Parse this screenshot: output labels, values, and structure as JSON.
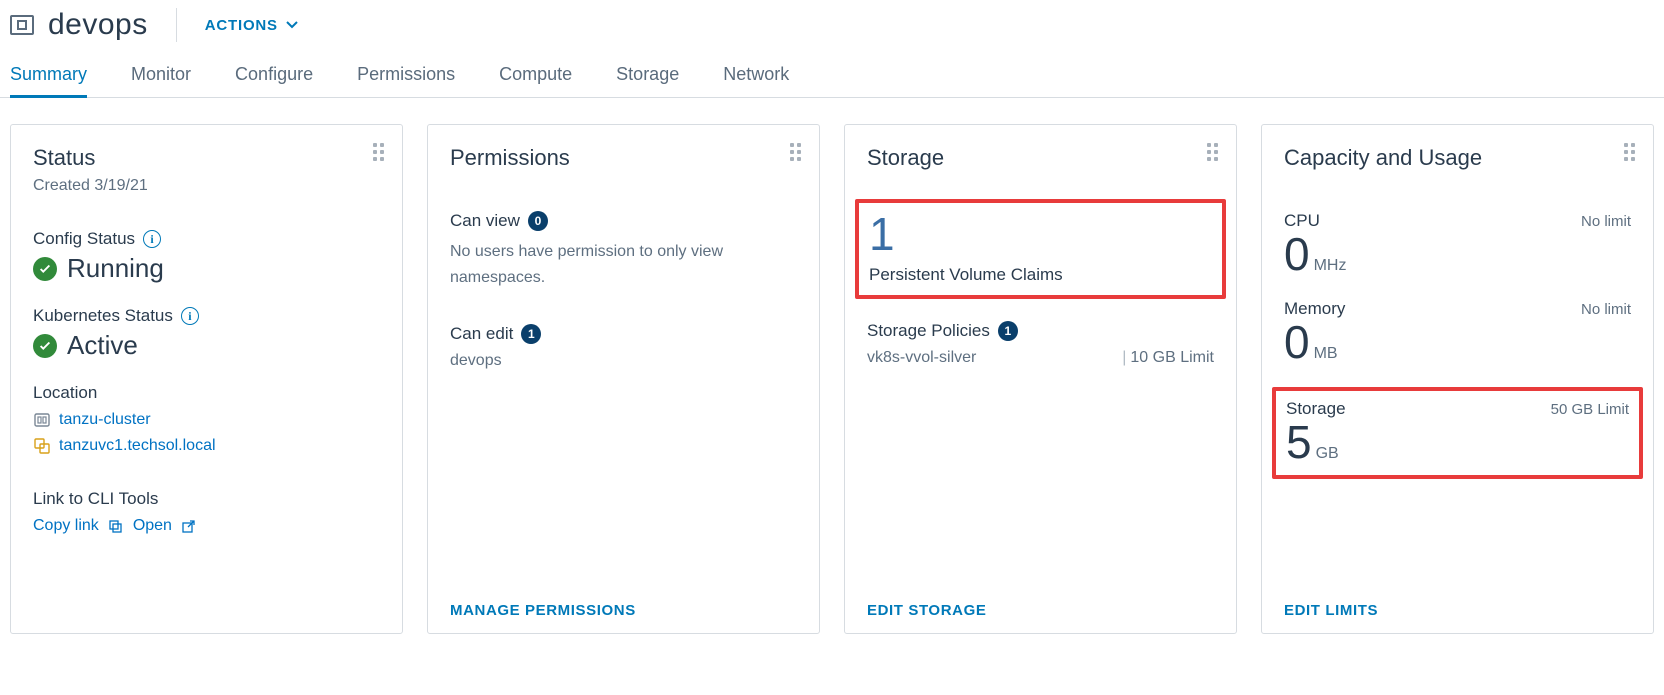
{
  "header": {
    "title": "devops",
    "actions_label": "ACTIONS"
  },
  "tabs": [
    "Summary",
    "Monitor",
    "Configure",
    "Permissions",
    "Compute",
    "Storage",
    "Network"
  ],
  "active_tab": "Summary",
  "status_card": {
    "title": "Status",
    "created_label": "Created 3/19/21",
    "config_status_label": "Config Status",
    "config_status_value": "Running",
    "k8s_status_label": "Kubernetes Status",
    "k8s_status_value": "Active",
    "location_label": "Location",
    "cluster_name": "tanzu-cluster",
    "vc_name": "tanzuvc1.techsol.local",
    "cli_label": "Link to CLI Tools",
    "copy_link_label": "Copy link",
    "open_label": "Open"
  },
  "permissions_card": {
    "title": "Permissions",
    "can_view_label": "Can view",
    "can_view_count": "0",
    "can_view_desc": "No users have permission to only view namespaces.",
    "can_edit_label": "Can edit",
    "can_edit_count": "1",
    "can_edit_user": "devops",
    "footer": "MANAGE PERMISSIONS"
  },
  "storage_card": {
    "title": "Storage",
    "pvc_count": "1",
    "pvc_label": "Persistent Volume Claims",
    "policies_label": "Storage Policies",
    "policies_count": "1",
    "policy_name": "vk8s-vvol-silver",
    "policy_limit": "10 GB Limit",
    "footer": "EDIT STORAGE"
  },
  "capacity_card": {
    "title": "Capacity and Usage",
    "cpu_label": "CPU",
    "cpu_limit": "No limit",
    "cpu_value": "0",
    "cpu_unit": "MHz",
    "mem_label": "Memory",
    "mem_limit": "No limit",
    "mem_value": "0",
    "mem_unit": "MB",
    "stor_label": "Storage",
    "stor_limit": "50 GB Limit",
    "stor_value": "5",
    "stor_unit": "GB",
    "footer": "EDIT LIMITS"
  }
}
